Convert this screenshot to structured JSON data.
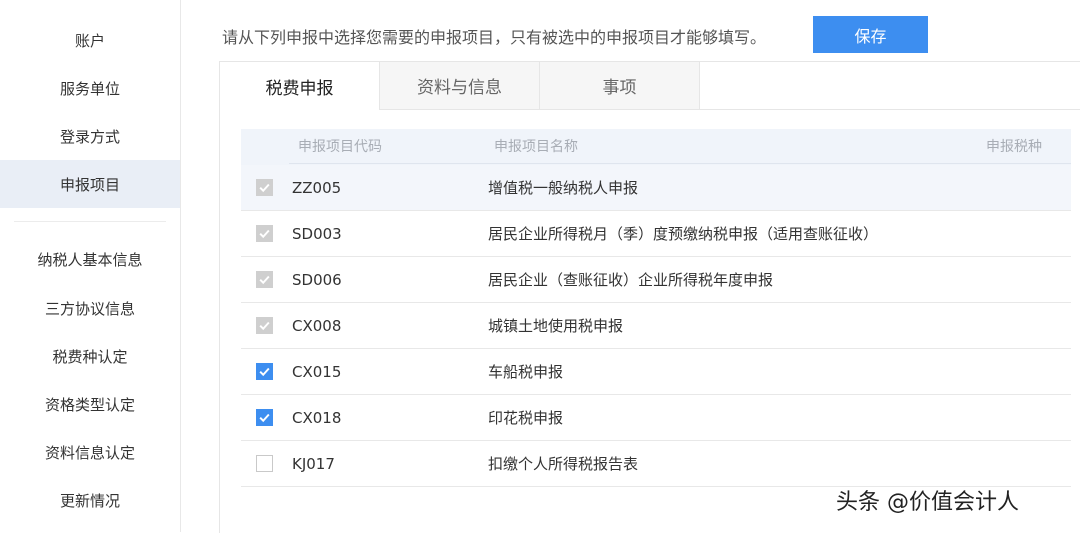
{
  "sidebar": {
    "items": [
      {
        "label": "账户"
      },
      {
        "label": "服务单位"
      },
      {
        "label": "登录方式"
      },
      {
        "label": "申报项目",
        "active": true
      },
      {
        "label": "纳税人基本信息"
      },
      {
        "label": "三方协议信息"
      },
      {
        "label": "税费种认定"
      },
      {
        "label": "资格类型认定"
      },
      {
        "label": "资料信息认定"
      },
      {
        "label": "更新情况"
      }
    ]
  },
  "header": {
    "hint": "请从下列申报中选择您需要的申报项目，只有被选中的申报项目才能够填写。",
    "save_label": "保存"
  },
  "tabs": [
    {
      "label": "税费申报",
      "active": true
    },
    {
      "label": "资料与信息"
    },
    {
      "label": "事项"
    }
  ],
  "table": {
    "columns": [
      "申报项目代码",
      "申报项目名称",
      "申报税种"
    ],
    "rows": [
      {
        "code": "ZZ005",
        "name": "增值税一般纳税人申报",
        "state": "checked-disabled"
      },
      {
        "code": "SD003",
        "name": "居民企业所得税月（季）度预缴纳税申报（适用查账征收）",
        "state": "checked-disabled"
      },
      {
        "code": "SD006",
        "name": "居民企业（查账征收）企业所得税年度申报",
        "state": "checked-disabled"
      },
      {
        "code": "CX008",
        "name": "城镇土地使用税申报",
        "state": "checked-disabled"
      },
      {
        "code": "CX015",
        "name": "车船税申报",
        "state": "checked"
      },
      {
        "code": "CX018",
        "name": "印花税申报",
        "state": "checked"
      },
      {
        "code": "KJ017",
        "name": "扣缴个人所得税报告表",
        "state": "unchecked"
      }
    ]
  },
  "watermark": "头条 @价值会计人",
  "colors": {
    "accent": "#3d8ef0",
    "active_bg": "#e9eef6",
    "disabled_check": "#cfcfcf"
  }
}
